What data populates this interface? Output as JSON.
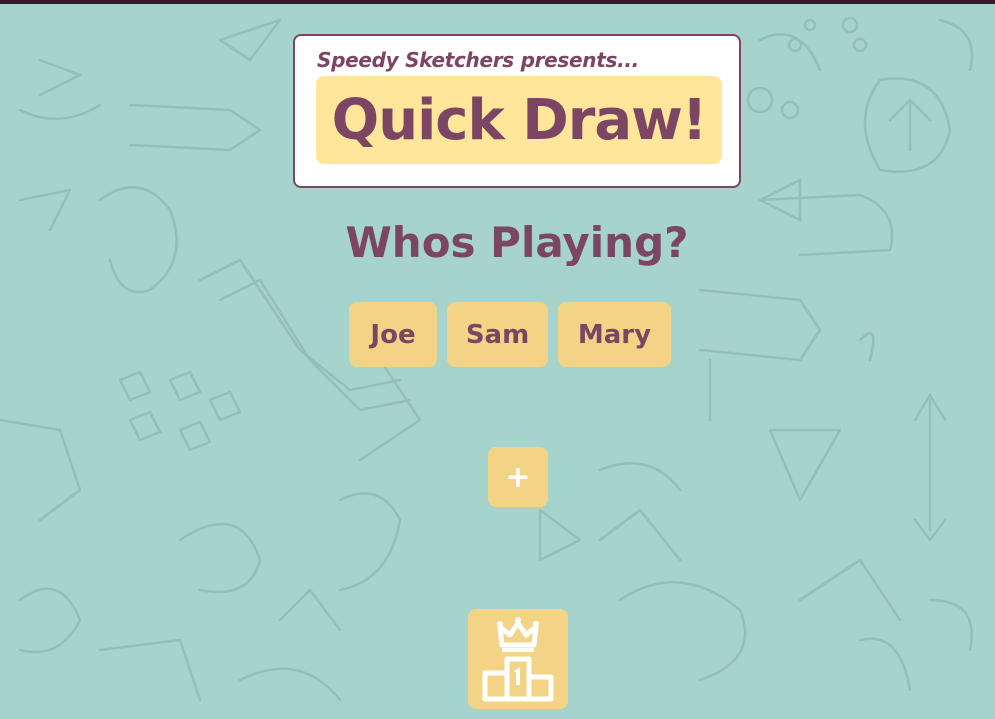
{
  "header": {
    "presents": "Speedy Sketchers presents...",
    "logo": "Quick Draw!"
  },
  "main": {
    "heading": "Whos Playing?",
    "players": [
      "Joe",
      "Sam",
      "Mary"
    ],
    "add_label": "+",
    "leaderboard_icon": "podium-crown-icon"
  },
  "colors": {
    "background": "#a6d3cb",
    "accent": "#7b4563",
    "button": "#f3d486",
    "logo_bg": "#ffe69b",
    "top_bar": "#3d1633"
  }
}
